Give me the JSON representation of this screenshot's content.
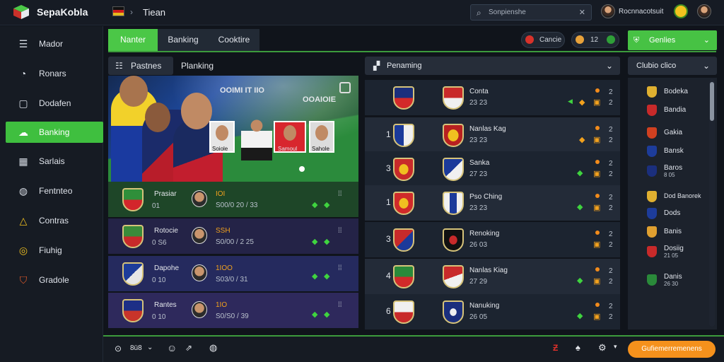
{
  "app": {
    "brand": "SepaKobla",
    "page_title": "Tiean",
    "separator": "›"
  },
  "search": {
    "placeholder": "Sonpienshe"
  },
  "user": {
    "name": "Rocnnacotsuit"
  },
  "sidebar": {
    "items": [
      {
        "label": "Mador",
        "icon": "list-icon",
        "active": false
      },
      {
        "label": "Ronars",
        "icon": "user-icon",
        "active": false
      },
      {
        "label": "Dodafen",
        "icon": "calendar-icon",
        "active": false
      },
      {
        "label": "Banking",
        "icon": "cloud-icon",
        "active": true
      },
      {
        "label": "Sarlais",
        "icon": "grid-icon",
        "active": false
      },
      {
        "label": "Fentnteo",
        "icon": "globe-icon",
        "active": false
      },
      {
        "label": "Contras",
        "icon": "triangle-icon",
        "active": false
      },
      {
        "label": "Fiuhig",
        "icon": "coin-icon",
        "active": false
      },
      {
        "label": "Gradole",
        "icon": "crest-icon",
        "active": false
      }
    ]
  },
  "tabs": [
    {
      "label": "Nanter",
      "active": true
    },
    {
      "label": "Banking",
      "active": false
    },
    {
      "label": "Cooktire",
      "active": false
    }
  ],
  "header_controls": {
    "pill_a": "Cancie",
    "pill_b": "12",
    "green_button": "Genlies"
  },
  "left_panel": {
    "tabs": [
      "Pastnes",
      "Planking"
    ],
    "hero": {
      "title": "OOIMI IT IIO",
      "subtitle": "OOAIOIE",
      "player_labels": [
        "Soiole",
        "Samoul",
        "Sahole"
      ]
    },
    "rows": [
      {
        "name": "Prasiar",
        "score": "IOI",
        "detail": "01",
        "meta": "S00/0 20 / 33",
        "bg": "#1d4a2a"
      },
      {
        "name": "Rotocie",
        "score": "SSH",
        "detail": "0 S6",
        "meta": "S0/00 / 2 25",
        "bg": "#26264a"
      },
      {
        "name": "Dapohe",
        "score": "1IOO",
        "detail": "0 10",
        "meta": "S03/0 / 31",
        "bg": "#262a5e"
      },
      {
        "name": "Rantes",
        "score": "1IO",
        "detail": "0 10",
        "meta": "S0/S0 / 39",
        "bg": "#302a60"
      }
    ]
  },
  "middle_panel": {
    "title": "Penaming",
    "rows": [
      {
        "rank": "",
        "name": "Conta",
        "meta": "23 23"
      },
      {
        "rank": "1",
        "name": "Nanlas Kag",
        "meta": "23 23"
      },
      {
        "rank": "3",
        "name": "Sanka",
        "meta": "27 23"
      },
      {
        "rank": "1",
        "name": "Pso Ching",
        "meta": "23 23"
      },
      {
        "rank": "3",
        "name": "Renoking",
        "meta": "26 03"
      },
      {
        "rank": "4",
        "name": "Nanlas Kiag",
        "meta": "27 29"
      },
      {
        "rank": "6",
        "name": "Nanuking",
        "meta": "26 05"
      }
    ]
  },
  "right_panel": {
    "title": "Clubio clico",
    "items": [
      {
        "name": "Bodeka",
        "sub": ""
      },
      {
        "name": "Bandia",
        "sub": ""
      },
      {
        "name": "Gakia",
        "sub": ""
      },
      {
        "name": "Bansk",
        "sub": ""
      },
      {
        "name": "Baros",
        "sub": "8 05"
      },
      {
        "name": "Dod Banorek",
        "sub": ""
      },
      {
        "name": "Dods",
        "sub": ""
      },
      {
        "name": "Banis",
        "sub": ""
      },
      {
        "name": "Dosiig",
        "sub": "21 05"
      },
      {
        "name": "Danis",
        "sub": "26 30"
      }
    ]
  },
  "bottom_bar": {
    "count": "8ü8",
    "orange_button": "Gufiemerremenens"
  },
  "colors": {
    "accent": "#4bc747",
    "orange": "#f5911c",
    "panel": "#1c222c"
  }
}
